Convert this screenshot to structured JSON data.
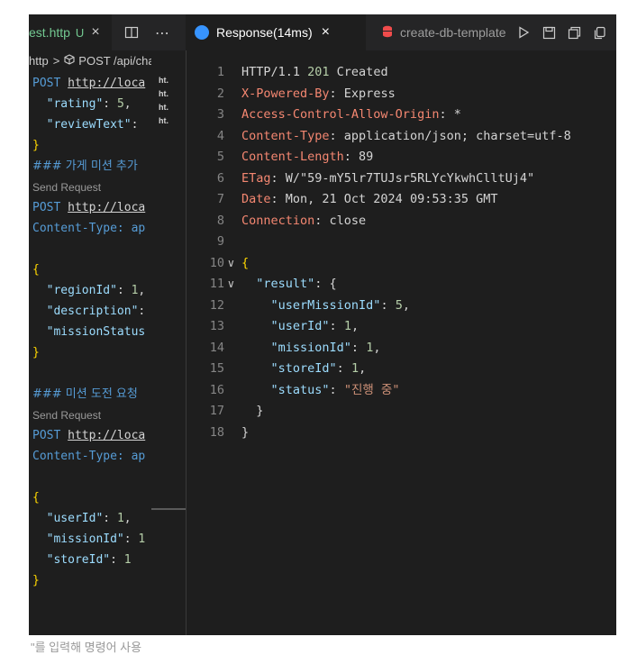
{
  "left_tabs": {
    "file_tab": {
      "label": "est.http",
      "status": "U"
    },
    "close_glyph": "×",
    "more_glyph": "⋯"
  },
  "right_tabs": {
    "response_tab": {
      "label": "Response(14ms)"
    },
    "db_tab": {
      "label": "create-db-template"
    },
    "close_glyph": "×"
  },
  "breadcrumb": {
    "file": "http",
    "separator": ">",
    "symbol": "POST /api/challen"
  },
  "minimap": [
    "ht.",
    "ht.",
    "ht.",
    "ht."
  ],
  "left_code": [
    {
      "t": "POST ",
      "u": "http://loca"
    },
    {
      "k": "\"rating\"",
      "p": ": ",
      "v": "5",
      "e": ","
    },
    {
      "k": "\"reviewText\"",
      "p": ": "
    },
    {
      "brace": "}"
    },
    {
      "comment": "### 가게 미션 추가"
    },
    {
      "lens": "Send Request"
    },
    {
      "t": "POST ",
      "u": "http://loca"
    },
    {
      "kw": "Content-Type",
      "p": ": ap"
    },
    {
      "blank": ""
    },
    {
      "brace": "{"
    },
    {
      "k": "\"regionId\"",
      "p": ": ",
      "v": "1",
      "e": ","
    },
    {
      "k": "\"description\"",
      "p": ":"
    },
    {
      "k": "\"missionStatus"
    },
    {
      "brace": "}"
    },
    {
      "blank": ""
    },
    {
      "comment": "### 미션 도전 요청"
    },
    {
      "lens": "Send Request"
    },
    {
      "t": "POST ",
      "u": "http://loca"
    },
    {
      "kw": "Content-Type",
      "p": ": ap"
    },
    {
      "blank": ""
    },
    {
      "brace": "{"
    },
    {
      "k": "\"userId\"",
      "p": ": ",
      "v": "1",
      "e": ","
    },
    {
      "k": "\"missionId\"",
      "p": ": ",
      "v": "1"
    },
    {
      "k": "\"storeId\"",
      "p": ": ",
      "v": "1"
    },
    {
      "brace": "}"
    }
  ],
  "response_lines": [
    {
      "n": "1",
      "parts": [
        {
          "c": "plain",
          "t": "HTTP/1.1 "
        },
        {
          "c": "num",
          "t": "201"
        },
        {
          "c": "plain",
          "t": " Created"
        }
      ]
    },
    {
      "n": "2",
      "parts": [
        {
          "c": "hkey",
          "t": "X-Powered-By"
        },
        {
          "c": "plain",
          "t": ": Express"
        }
      ]
    },
    {
      "n": "3",
      "parts": [
        {
          "c": "hkey",
          "t": "Access-Control-Allow-Origin"
        },
        {
          "c": "plain",
          "t": ": *"
        }
      ]
    },
    {
      "n": "4",
      "parts": [
        {
          "c": "hkey",
          "t": "Content-Type"
        },
        {
          "c": "plain",
          "t": ": application/json; charset=utf-8"
        }
      ]
    },
    {
      "n": "5",
      "parts": [
        {
          "c": "hkey",
          "t": "Content-Length"
        },
        {
          "c": "plain",
          "t": ": 89"
        }
      ]
    },
    {
      "n": "6",
      "parts": [
        {
          "c": "hkey",
          "t": "ETag"
        },
        {
          "c": "plain",
          "t": ": W/\"59-mY5lr7TUJsr5RLYcYkwhClltUj4\""
        }
      ]
    },
    {
      "n": "7",
      "parts": [
        {
          "c": "hkey",
          "t": "Date"
        },
        {
          "c": "plain",
          "t": ": Mon, 21 Oct 2024 09:53:35 GMT"
        }
      ]
    },
    {
      "n": "8",
      "parts": [
        {
          "c": "hkey",
          "t": "Connection"
        },
        {
          "c": "plain",
          "t": ": close"
        }
      ]
    },
    {
      "n": "9",
      "parts": []
    },
    {
      "n": "10",
      "fold": "∨",
      "parts": [
        {
          "c": "brace",
          "t": "{"
        }
      ]
    },
    {
      "n": "11",
      "fold": "∨",
      "parts": [
        {
          "c": "plain",
          "t": "  "
        },
        {
          "c": "jkey",
          "t": "\"result\""
        },
        {
          "c": "plain",
          "t": ": {"
        }
      ]
    },
    {
      "n": "12",
      "parts": [
        {
          "c": "plain",
          "t": "    "
        },
        {
          "c": "jkey",
          "t": "\"userMissionId\""
        },
        {
          "c": "plain",
          "t": ": "
        },
        {
          "c": "num",
          "t": "5"
        },
        {
          "c": "plain",
          "t": ","
        }
      ]
    },
    {
      "n": "13",
      "parts": [
        {
          "c": "plain",
          "t": "    "
        },
        {
          "c": "jkey",
          "t": "\"userId\""
        },
        {
          "c": "plain",
          "t": ": "
        },
        {
          "c": "num",
          "t": "1"
        },
        {
          "c": "plain",
          "t": ","
        }
      ]
    },
    {
      "n": "14",
      "parts": [
        {
          "c": "plain",
          "t": "    "
        },
        {
          "c": "jkey",
          "t": "\"missionId\""
        },
        {
          "c": "plain",
          "t": ": "
        },
        {
          "c": "num",
          "t": "1"
        },
        {
          "c": "plain",
          "t": ","
        }
      ]
    },
    {
      "n": "15",
      "parts": [
        {
          "c": "plain",
          "t": "    "
        },
        {
          "c": "jkey",
          "t": "\"storeId\""
        },
        {
          "c": "plain",
          "t": ": "
        },
        {
          "c": "num",
          "t": "1"
        },
        {
          "c": "plain",
          "t": ","
        }
      ]
    },
    {
      "n": "16",
      "parts": [
        {
          "c": "plain",
          "t": "    "
        },
        {
          "c": "jkey",
          "t": "\"status\""
        },
        {
          "c": "plain",
          "t": ": "
        },
        {
          "c": "str",
          "t": "\"진행 중\""
        }
      ]
    },
    {
      "n": "17",
      "parts": [
        {
          "c": "plain",
          "t": "  }"
        }
      ]
    },
    {
      "n": "18",
      "parts": [
        {
          "c": "plain",
          "t": "}"
        }
      ]
    }
  ],
  "footer": {
    "text": "\"를 입력해 명령어 사용"
  },
  "colors": {
    "editor_bg": "#1e1e1e",
    "tabbar_bg": "#252526",
    "untracked_green": "#73c991",
    "header_key": "#f48771",
    "json_key": "#9cdcfe",
    "number": "#b5cea8",
    "string": "#ce9178",
    "keyword": "#569cd6",
    "bracket": "#ffd700",
    "db_icon": "#f14c4c",
    "response_icon": "#3794ff"
  },
  "icons": [
    "close-icon",
    "split-editor-icon",
    "more-actions-icon",
    "response-icon",
    "database-icon",
    "run-icon",
    "save-icon",
    "open-changes-icon",
    "copy-icon",
    "split-editor-right-icon"
  ]
}
